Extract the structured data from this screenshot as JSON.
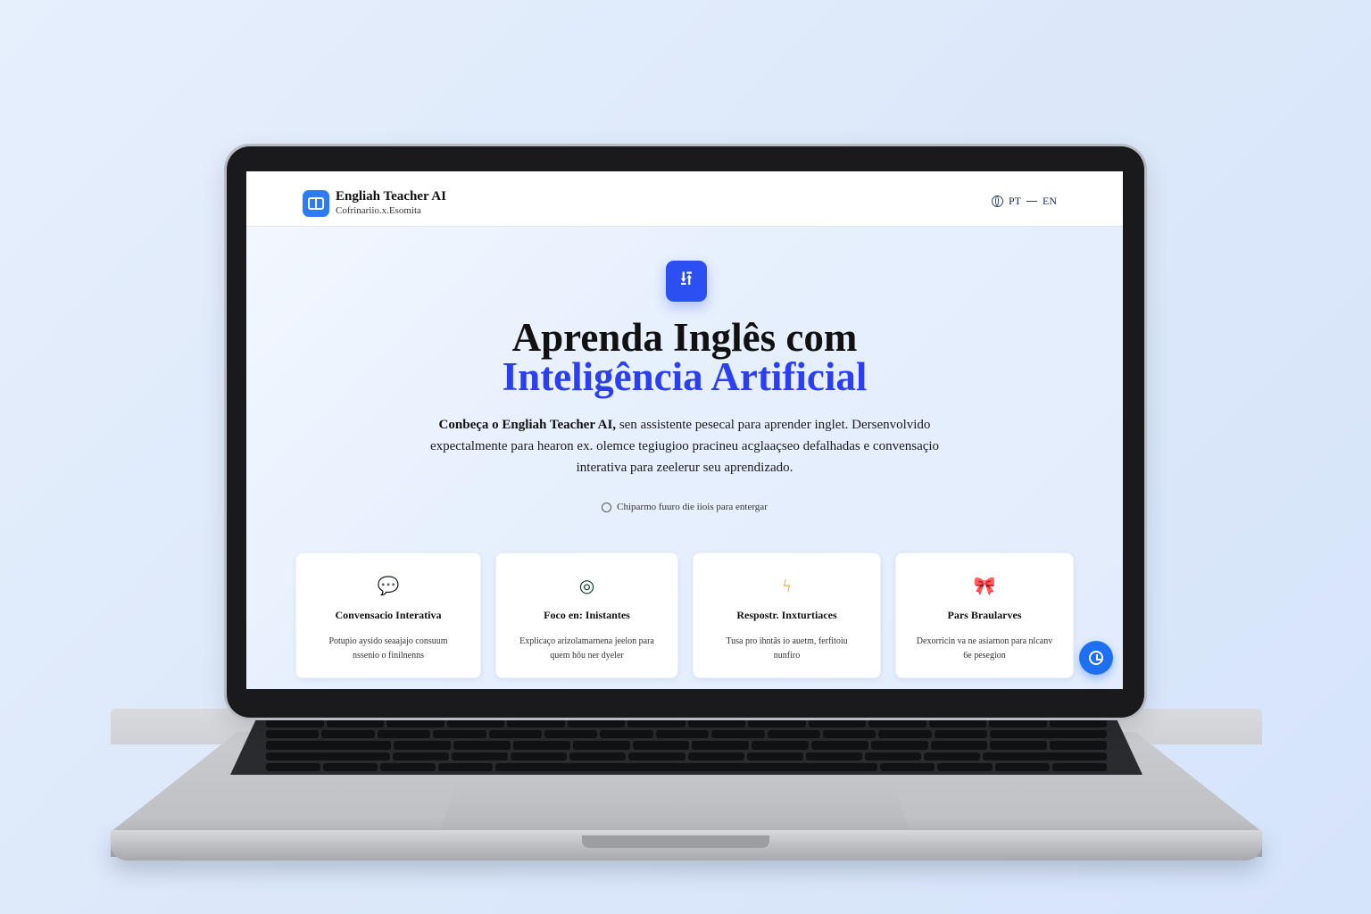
{
  "brand": {
    "title": "Engliah Teacher AI",
    "subtitle": "Cofrinariio.x.Esomita"
  },
  "language": {
    "pt": "PT",
    "en": "EN"
  },
  "hero": {
    "icon": "⭿",
    "title_line1": "Aprenda Inglês com",
    "title_line2": "Inteligência Artificial",
    "desc_bold": "Conbeça o Engliah Teacher AI,",
    "desc_rest": " sen assistente pesecal para aprender inglet. Dersenvolvido expectalmente para hearon ex. olemce tegiugioo pracineu acglaaçseo defalhadas e convensaçio interativa para zeelerur seu aprendizado.",
    "hint": "Chiparmo fuuro die iiois para entergar"
  },
  "cards": [
    {
      "icon": "chat-bubble-icon",
      "glyph": "💬",
      "color": "#1d3fe0",
      "title": "Convensacio Interativa",
      "desc": "Potupio aysido seaajajo consuum nssenio o finilnenns"
    },
    {
      "icon": "target-icon",
      "glyph": "◎",
      "color": "#0a3b2a",
      "title": "Foco en: Inistantes",
      "desc": "Explicaço arizolamarnena jeelon para quem hôu ner dyeler"
    },
    {
      "icon": "lightning-icon",
      "glyph": "ϟ",
      "color": "#f0a020",
      "title": "Respostr. Inxturtiaces",
      "desc": "Tusa pro ihntãs io auetm, ferfitoiu nunfiro"
    },
    {
      "icon": "ribbon-icon",
      "glyph": "🎀",
      "color": "#6a2fd6",
      "title": "Pars Braularves",
      "desc": "Dexorricin va ne asiarnon para nlcanv 6e pesegion"
    }
  ],
  "fab": {
    "icon": "clock-icon"
  }
}
